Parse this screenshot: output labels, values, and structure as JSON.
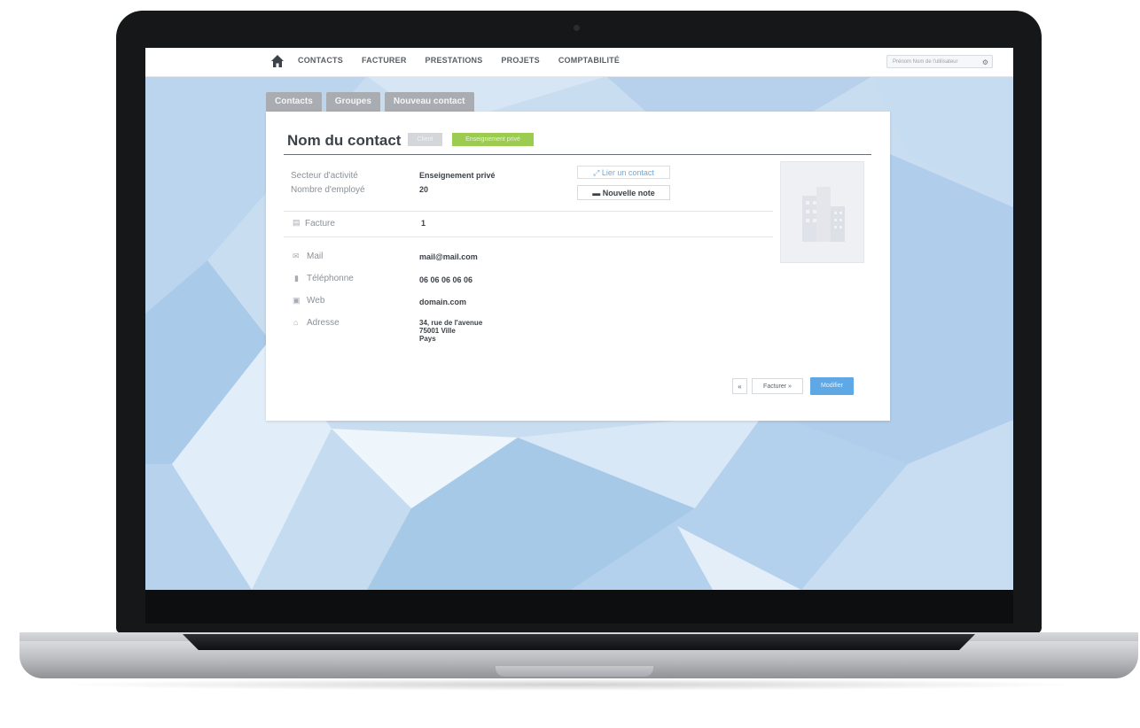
{
  "nav": {
    "items": [
      "CONTACTS",
      "FACTURER",
      "PRESTATIONS",
      "PROJETS",
      "COMPTABILITÉ"
    ],
    "user_label": "Prénom Nom de l'utilisateur"
  },
  "tabs": [
    "Contacts",
    "Groupes",
    "Nouveau contact"
  ],
  "contact": {
    "title": "Nom du contact",
    "badge_client": "Client",
    "badge_sector": "Enseignement privé",
    "fields": [
      {
        "label": "Secteur d'activité",
        "value": "Enseignement privé"
      },
      {
        "label": "Nombre d'employé",
        "value": "20"
      }
    ],
    "facture": {
      "label": "Facture",
      "value": "1"
    },
    "details": [
      {
        "icon": "mail-icon",
        "label": "Mail",
        "value": "mail@mail.com"
      },
      {
        "icon": "phone-icon",
        "label": "Téléphonne",
        "value": "06 06 06 06 06"
      },
      {
        "icon": "web-icon",
        "label": "Web",
        "value": "domain.com"
      },
      {
        "icon": "address-icon",
        "label": "Adresse",
        "value": [
          "34, rue de l'avenue",
          "75001 Ville",
          "Pays"
        ]
      }
    ],
    "actions": {
      "link_contact": "Lier un contact",
      "new_note": "Nouvelle note",
      "small": "«",
      "facturer": "Facturer »",
      "modifier": "Modifier"
    }
  },
  "colors": {
    "accent_blue": "#5fa8e6",
    "badge_green": "#9ccc4f",
    "tab_gray": "#a9acb0"
  }
}
